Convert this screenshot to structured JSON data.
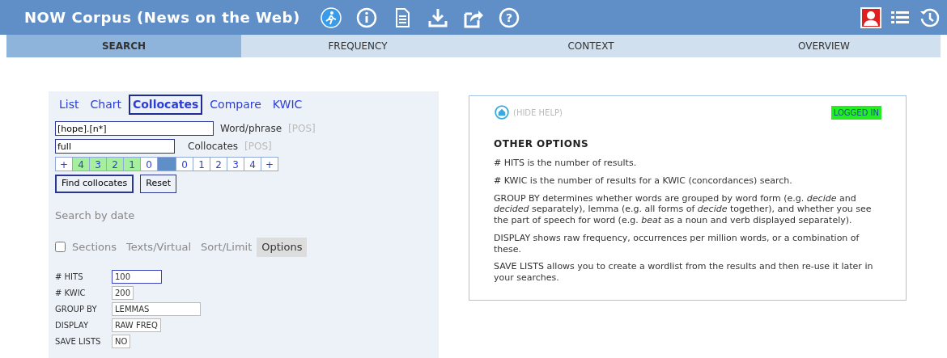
{
  "header": {
    "title": "NOW Corpus (News on the Web)",
    "help_icon": "?"
  },
  "tabs": [
    {
      "label": "SEARCH",
      "selected": true
    },
    {
      "label": "FREQUENCY",
      "selected": false
    },
    {
      "label": "CONTEXT",
      "selected": false
    },
    {
      "label": "OVERVIEW",
      "selected": false
    }
  ],
  "search_panel": {
    "modes": [
      {
        "label": "List",
        "selected": false
      },
      {
        "label": "Chart",
        "selected": false
      },
      {
        "label": "Collocates",
        "selected": true
      },
      {
        "label": "Compare",
        "selected": false
      },
      {
        "label": "KWIC",
        "selected": false
      }
    ],
    "word_field": {
      "value": "[hope].[n*]",
      "label": "Word/phrase",
      "pos": "[POS]"
    },
    "collocates_field": {
      "value": "full",
      "label": "Collocates",
      "pos": "[POS]"
    },
    "span": [
      {
        "kind": "plus",
        "label": "+",
        "selected": false
      },
      {
        "kind": "num",
        "label": "4",
        "selected": true
      },
      {
        "kind": "num",
        "label": "3",
        "selected": true
      },
      {
        "kind": "num",
        "label": "2",
        "selected": true
      },
      {
        "kind": "num",
        "label": "1",
        "selected": true
      },
      {
        "kind": "num",
        "label": "0",
        "selected": false
      },
      {
        "kind": "node"
      },
      {
        "kind": "num",
        "label": "0",
        "selected": false
      },
      {
        "kind": "num",
        "label": "1",
        "selected": false
      },
      {
        "kind": "num",
        "label": "2",
        "selected": false
      },
      {
        "kind": "num",
        "label": "3",
        "selected": false
      },
      {
        "kind": "num",
        "label": "4",
        "selected": false
      },
      {
        "kind": "plus",
        "label": "+",
        "selected": false
      }
    ],
    "buttons": [
      "Find collocates",
      "Reset"
    ],
    "search_by_date": "Search by date",
    "sections": {
      "label": "Sections",
      "checked": false
    },
    "section_tabs": [
      {
        "label": "Texts/Virtual",
        "selected": false
      },
      {
        "label": "Sort/Limit",
        "selected": false
      },
      {
        "label": "Options",
        "selected": true
      }
    ],
    "options": [
      {
        "label": "# HITS",
        "value": "100"
      },
      {
        "label": "# KWIC",
        "value": "200"
      },
      {
        "label": "GROUP BY",
        "value": "LEMMAS"
      },
      {
        "label": "DISPLAY",
        "value": "RAW FREQ"
      },
      {
        "label": "SAVE LISTS",
        "value": "NO"
      }
    ]
  },
  "help": {
    "hide_link": "(HIDE HELP)",
    "status": "LOGGED IN",
    "heading": "OTHER OPTIONS",
    "paragraphs": [
      "# HITS is the number of results.",
      "# KWIC is the number of results for a KWIC (concordances) search.",
      "GROUP BY determines whether words are grouped by word form (e.g. *decide* and *decided* separately), lemma (e.g. all forms of *decide* together), and whether you see the part of speech for word (e.g. *beat* as a noun and verb displayed separately).",
      "DISPLAY shows raw frequency, occurrences per million words, or a combination of these.",
      "SAVE LISTS allows you to create a wordlist from the results and then re-use it later in your searches."
    ]
  }
}
